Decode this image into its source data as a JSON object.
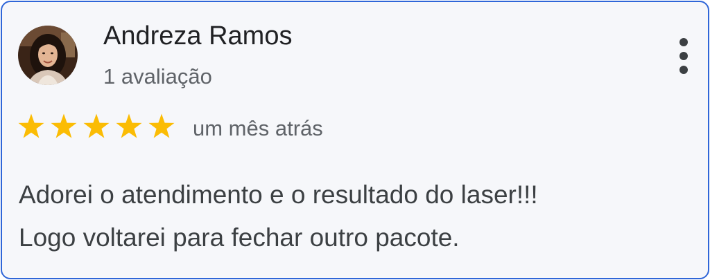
{
  "review": {
    "author_name": "Andreza Ramos",
    "review_count": "1 avaliação",
    "rating": 5,
    "rating_max": 5,
    "date": "um mês atrás",
    "text_lines": [
      "Adorei o atendimento e o resultado do laser!!!",
      "Logo voltarei para fechar outro pacote."
    ]
  },
  "icons": {
    "star": "star-icon",
    "more": "more-vert-icon",
    "avatar": "profile-photo"
  },
  "colors": {
    "card_border": "#2f66d8",
    "card_background": "#f6f7fa",
    "star": "#fbbc04",
    "name_text": "#202124",
    "secondary_text": "#5f6368",
    "body_text": "#3c4043"
  }
}
